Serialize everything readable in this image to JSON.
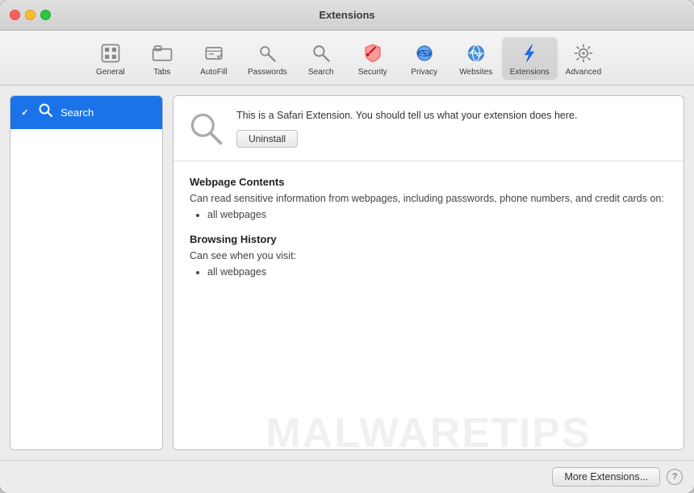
{
  "window": {
    "title": "Extensions"
  },
  "titlebar": {
    "title": "Extensions"
  },
  "toolbar": {
    "items": [
      {
        "id": "general",
        "label": "General",
        "icon": "general"
      },
      {
        "id": "tabs",
        "label": "Tabs",
        "icon": "tabs"
      },
      {
        "id": "autofill",
        "label": "AutoFill",
        "icon": "autofill"
      },
      {
        "id": "passwords",
        "label": "Passwords",
        "icon": "passwords"
      },
      {
        "id": "search",
        "label": "Search",
        "icon": "search"
      },
      {
        "id": "security",
        "label": "Security",
        "icon": "security"
      },
      {
        "id": "privacy",
        "label": "Privacy",
        "icon": "privacy"
      },
      {
        "id": "websites",
        "label": "Websites",
        "icon": "websites"
      },
      {
        "id": "extensions",
        "label": "Extensions",
        "icon": "extensions"
      },
      {
        "id": "advanced",
        "label": "Advanced",
        "icon": "advanced"
      }
    ]
  },
  "sidebar": {
    "items": [
      {
        "id": "search-ext",
        "label": "Search",
        "checked": true
      }
    ]
  },
  "detail": {
    "description": "This is a Safari Extension. You should tell us what your extension does here.",
    "uninstall_label": "Uninstall",
    "permissions": [
      {
        "title": "Webpage Contents",
        "description": "Can read sensitive information from webpages, including passwords, phone numbers, and credit cards on:",
        "items": [
          "all webpages"
        ]
      },
      {
        "title": "Browsing History",
        "description": "Can see when you visit:",
        "items": [
          "all webpages"
        ]
      }
    ]
  },
  "bottombar": {
    "more_extensions_label": "More Extensions...",
    "help_label": "?"
  },
  "watermark": {
    "text": "MALWARETIPS"
  }
}
